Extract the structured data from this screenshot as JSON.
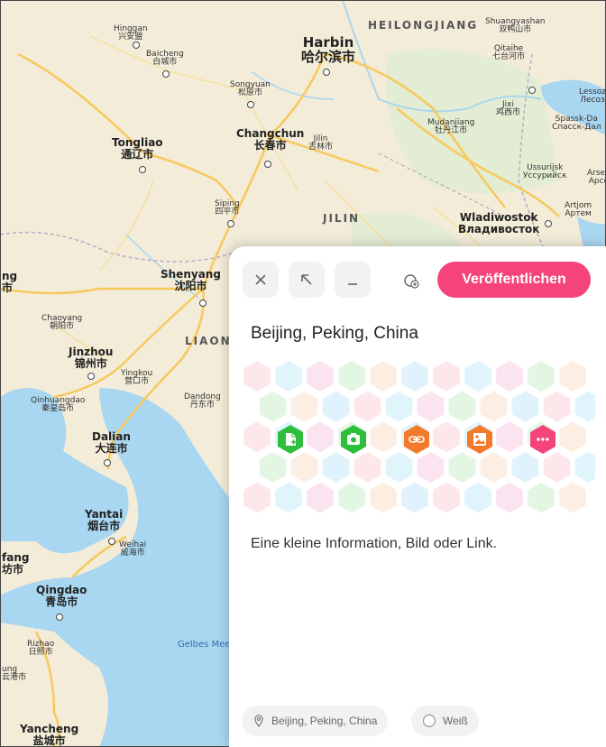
{
  "map": {
    "province_labels": [
      "HEILONGJIANG",
      "JILIN",
      "LIAONING"
    ],
    "sea_label": "Gelbes Mee",
    "cities": [
      {
        "en": "Hinggan",
        "zh": "兴安盟"
      },
      {
        "en": "Baicheng",
        "zh": "白城市"
      },
      {
        "en": "Songyuan",
        "zh": "松原市"
      },
      {
        "en": "Harbin",
        "zh": "哈尔滨市"
      },
      {
        "en": "Shuangyashan",
        "zh": "双鸭山市"
      },
      {
        "en": "Qitaihe",
        "zh": "七台河市"
      },
      {
        "en": "Jixi",
        "zh": "鸡西市"
      },
      {
        "en": "Mudanjiang",
        "zh": "牡丹江市"
      },
      {
        "en": "Lessoz",
        "zh": "Лесоз"
      },
      {
        "en": "Spassk-Da",
        "zh": "Спасск-Дал"
      },
      {
        "en": "Ussurijsk",
        "zh": "Уссурийск"
      },
      {
        "en": "Arsen",
        "zh": "Арсе"
      },
      {
        "en": "Artjom",
        "zh": "Артем"
      },
      {
        "en": "Wladiwostok",
        "zh": "Владивосток"
      },
      {
        "en": "Tongliao",
        "zh": "通辽市"
      },
      {
        "en": "Changchun",
        "zh": "长春市"
      },
      {
        "en": "Jilin",
        "zh": "吉林市"
      },
      {
        "en": "Siping",
        "zh": "四平市"
      },
      {
        "en": "Shenyang",
        "zh": "沈阳市"
      },
      {
        "en": "Chaoyang",
        "zh": "朝阳市"
      },
      {
        "en": "Jinzhou",
        "zh": "锦州市"
      },
      {
        "en": "Yingkou",
        "zh": "营口市"
      },
      {
        "en": "Qinhuangdao",
        "zh": "秦皇岛市"
      },
      {
        "en": "Dandong",
        "zh": "丹东市"
      },
      {
        "en": "Dalian",
        "zh": "大连市"
      },
      {
        "en": "Yantai",
        "zh": "烟台市"
      },
      {
        "en": "Weihai",
        "zh": "威海市"
      },
      {
        "en": "Qingdao",
        "zh": "青岛市"
      },
      {
        "en": "Rizhao",
        "zh": "日照市"
      },
      {
        "en": "Yancheng",
        "zh": "盐城市"
      },
      {
        "en": "fang",
        "zh": "坊市"
      },
      {
        "en": "ung",
        "zh": "云港市"
      },
      {
        "en": "ng",
        "zh": "市"
      }
    ]
  },
  "panel": {
    "publish_label": "Veröffentlichen",
    "title": "Beijing, Peking, China",
    "info_text": "Eine kleine Information, Bild oder Link.",
    "location_chip": "Beijing, Peking, China",
    "color_chip": "Weiß",
    "icons": [
      {
        "name": "document-icon",
        "color": "#2dbf3c"
      },
      {
        "name": "camera-icon",
        "color": "#2dbf3c"
      },
      {
        "name": "link-icon",
        "color": "#f47a2b"
      },
      {
        "name": "image-icon",
        "color": "#f47a2b"
      },
      {
        "name": "more-icon",
        "color": "#f5447a"
      }
    ]
  },
  "colors": {
    "accent": "#f5447a",
    "land": "#f3ecd9",
    "water": "#a9d6f0",
    "road": "#f7c95c"
  }
}
